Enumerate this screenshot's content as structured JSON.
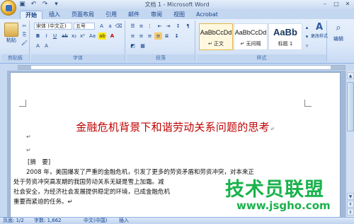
{
  "window": {
    "title": "文档 1 - Microsoft Word"
  },
  "tabs": [
    "开始",
    "插入",
    "页面布局",
    "引用",
    "邮件",
    "审阅",
    "视图",
    "Acrobat"
  ],
  "ribbon": {
    "clipboard": {
      "paste_label": "粘贴",
      "group_label": "剪贴板"
    },
    "font": {
      "font_name": "宋体 (中文正)",
      "font_size": "五号",
      "group_label": "字体"
    },
    "paragraph": {
      "group_label": "段落"
    },
    "styles": {
      "items": [
        {
          "sample": "AaBbCcDd",
          "name": "↵ 正文"
        },
        {
          "sample": "AaBbCcDd",
          "name": "↵ 无间隔"
        },
        {
          "sample": "AaBb",
          "name": "标题 1"
        }
      ],
      "change_label": "更改样式",
      "group_label": "样式"
    },
    "editing": {
      "label": "编辑"
    }
  },
  "document": {
    "title": "金融危机背景下和谐劳动关系问题的思考",
    "abstract_label": "[摘　要]",
    "lines": [
      "2008 年，美国爆发了严重的金融危机，引发了更多的劳资矛盾和劳资冲突，对本来正",
      "处于劳资冲突高发期的我国劳动关系无疑是雪上加霜。减",
      "社会安全，为经济社会发展提供稳定的环境，已成金融危机",
      "重要而紧迫的任务。↵"
    ]
  },
  "statusbar": {
    "page": "页面: 1/2",
    "words": "字数: 1,662",
    "lang": "中文(中国)",
    "mode": "插入"
  },
  "watermark": {
    "brand": "技术员联盟",
    "url": "www.jsgho.com"
  },
  "colors": {
    "title_red": "#c00000",
    "watermark_green": "#19b24b"
  }
}
